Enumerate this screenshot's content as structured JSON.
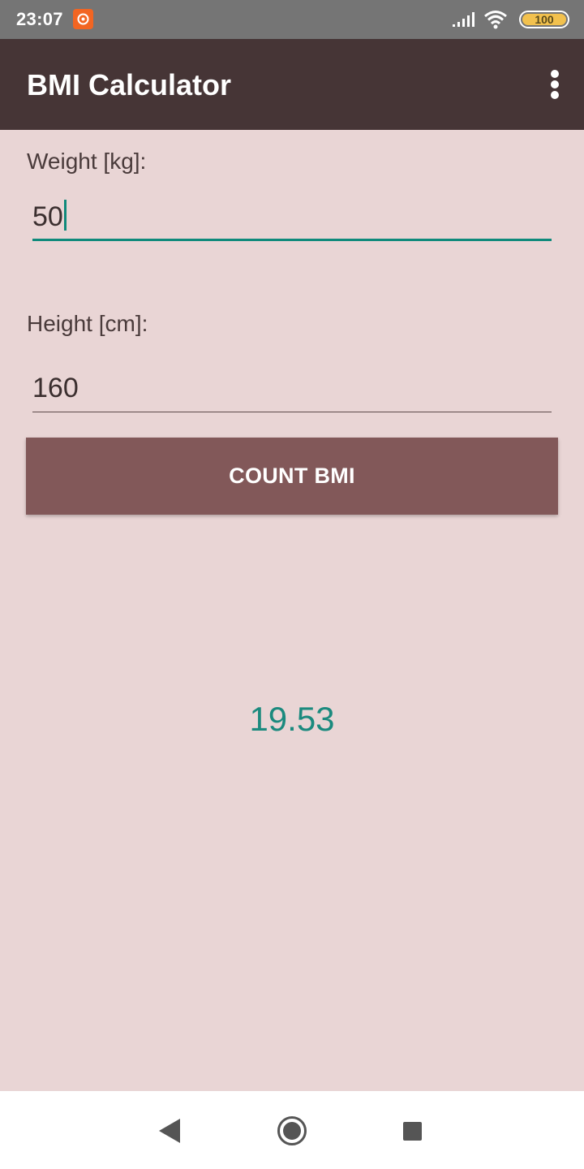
{
  "status_bar": {
    "time": "23:07",
    "battery_level": "100",
    "icons": [
      "app-notification-icon",
      "signal-icon",
      "wifi-icon",
      "battery-icon"
    ]
  },
  "app_bar": {
    "title": "BMI Calculator",
    "menu_icon": "overflow-menu-icon"
  },
  "form": {
    "weight_label": "Weight [kg]:",
    "weight_value": "50",
    "height_label": "Height [cm]:",
    "height_value": "160",
    "count_button_label": "COUNT BMI"
  },
  "result": {
    "bmi": "19.53"
  },
  "nav_bar": {
    "icons": [
      "back-icon",
      "home-icon",
      "recents-icon"
    ]
  },
  "colors": {
    "background": "#e9d5d5",
    "app_bar": "#463536",
    "button": "#825859",
    "accent": "#0f8a7b",
    "result_text": "#1b8a7e"
  }
}
